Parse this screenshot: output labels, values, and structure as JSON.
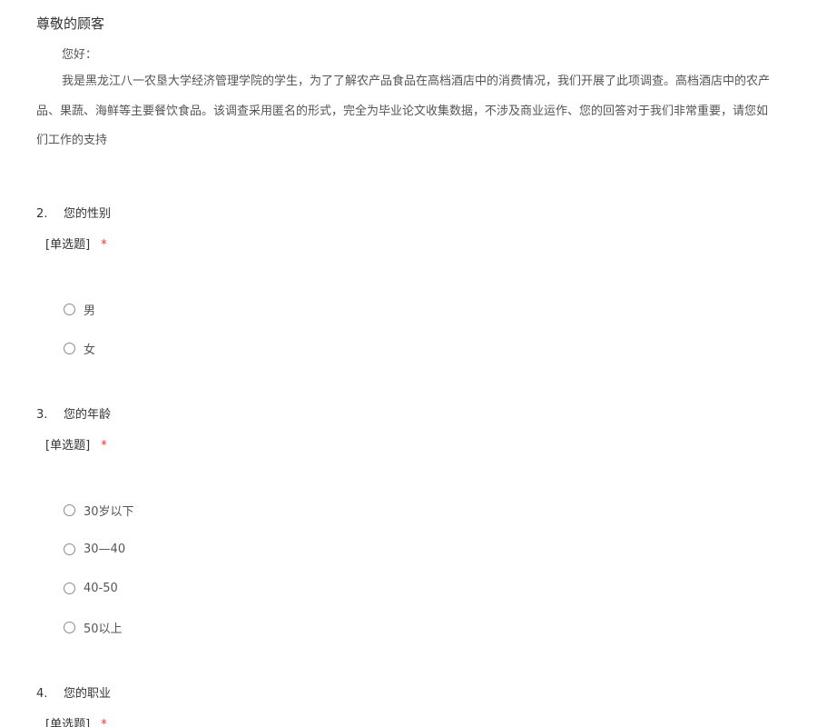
{
  "intro": {
    "title": "尊敬的顾客",
    "hello": "您好：",
    "line1": "我是黑龙江八一农垦大学经济管理学院的学生，为了了解农产品食品在高档酒店中的消费情况，我们开展了此项调查。高档酒店中的农产",
    "line2": "品、果蔬、海鲜等主要餐饮食品。该调查采用匿名的形式，完全为毕业论文收集数据，不涉及商业运作、您的回答对于我们非常重要，请您如",
    "line3": "们工作的支持"
  },
  "questions": [
    {
      "number": "2.",
      "title": "您的性别",
      "type": "[单选题]",
      "required_mark": "*",
      "options": [
        "男",
        "女"
      ]
    },
    {
      "number": "3.",
      "title": "您的年龄",
      "type": "[单选题]",
      "required_mark": "*",
      "options": [
        "30岁以下",
        "30—40",
        "40-50",
        "50以上"
      ]
    },
    {
      "number": "4.",
      "title": "您的职业",
      "type": "[单选题]",
      "required_mark": "*",
      "options": []
    }
  ]
}
